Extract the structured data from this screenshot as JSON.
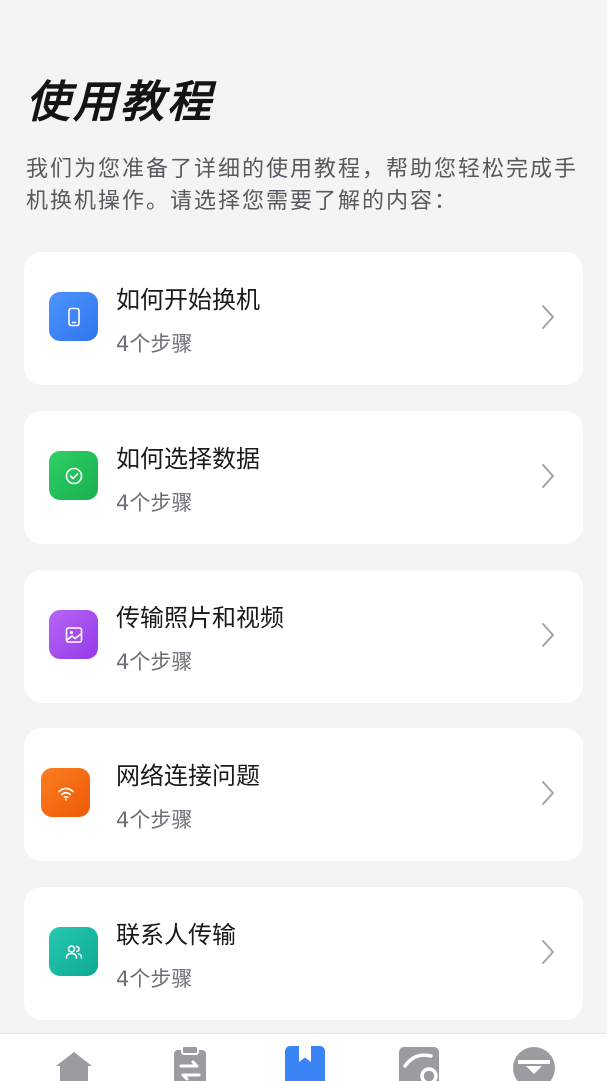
{
  "page": {
    "title": "使用教程",
    "description": "我们为您准备了详细的使用教程，帮助您轻松完成手机换机操作。请选择您需要了解的内容："
  },
  "tutorials": [
    {
      "title": "如何开始换机",
      "steps": "4个步骤",
      "icon": "phone-icon",
      "color": "#3a84f6"
    },
    {
      "title": "如何选择数据",
      "steps": "4个步骤",
      "icon": "check-circle-icon",
      "color": "#22c45e"
    },
    {
      "title": "传输照片和视频",
      "steps": "4个步骤",
      "icon": "image-icon",
      "color": "#a64ff0"
    },
    {
      "title": "网络连接问题",
      "steps": "4个步骤",
      "icon": "wifi-icon",
      "color": "#f56a12"
    },
    {
      "title": "联系人传输",
      "steps": "4个步骤",
      "icon": "users-icon",
      "color": "#16b8a0"
    }
  ],
  "nav": {
    "items": [
      "home-icon",
      "transfer-icon",
      "tutorial-icon",
      "gallery-icon",
      "profile-icon"
    ],
    "active": "tutorial-icon",
    "active_color": "#3a84f6",
    "inactive_color": "#9a9ca2"
  }
}
